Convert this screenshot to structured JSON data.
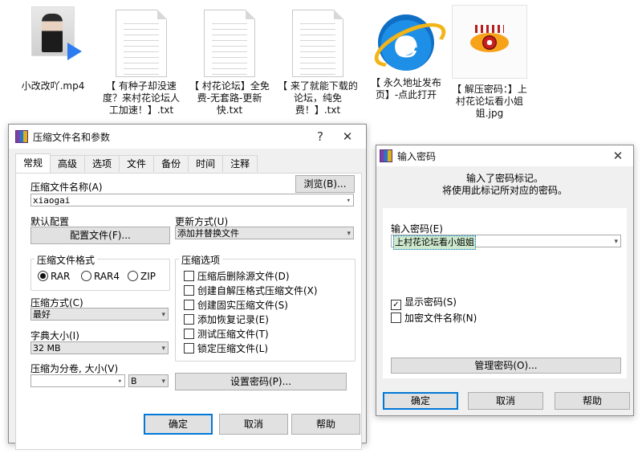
{
  "desktop": {
    "icons": [
      {
        "label": "小改改吖.mp4",
        "kind": "video"
      },
      {
        "label": "【 有种子却没速度？来村花论坛人工加速！】.txt",
        "kind": "txt"
      },
      {
        "label": "【 村花论坛】全免费-无套路-更新快.txt",
        "kind": "txt"
      },
      {
        "label": "【 来了就能下载的论坛，纯免费！】.txt",
        "kind": "txt"
      },
      {
        "label": "【 永久地址发布页】-点此打开",
        "kind": "ie"
      },
      {
        "label": "【 解压密码：】上村花论坛看小姐姐.jpg",
        "kind": "jpg"
      }
    ]
  },
  "archive_dialog": {
    "title": "压缩文件名和参数",
    "help_glyph": "?",
    "close_glyph": "✕",
    "tabs": [
      "常规",
      "高级",
      "选项",
      "文件",
      "备份",
      "时间",
      "注释"
    ],
    "archive_name_label": "压缩文件名称(A)",
    "browse_button": "浏览(B)...",
    "archive_name_value": "xiaogai",
    "default_profile_label": "默认配置",
    "profile_button": "配置文件(F)...",
    "update_mode_label": "更新方式(U)",
    "update_mode_value": "添加并替换文件",
    "format_group_title": "压缩文件格式",
    "formats": [
      "RAR",
      "RAR4",
      "ZIP"
    ],
    "format_selected": "RAR",
    "options_group_title": "压缩选项",
    "options": [
      "压缩后删除源文件(D)",
      "创建自解压格式压缩文件(X)",
      "创建固实压缩文件(S)",
      "添加恢复记录(E)",
      "测试压缩文件(T)",
      "锁定压缩文件(L)"
    ],
    "method_label": "压缩方式(C)",
    "method_value": "最好",
    "dict_label": "字典大小(I)",
    "dict_value": "32 MB",
    "split_label": "压缩为分卷, 大小(V)",
    "split_value": "",
    "split_unit": "B",
    "set_password_button": "设置密码(P)...",
    "ok_button": "确定",
    "cancel_button": "取消",
    "help_button": "帮助"
  },
  "password_dialog": {
    "title": "输入密码",
    "close_glyph": "✕",
    "message_line1": "输入了密码标记。",
    "message_line2": "将使用此标记所对应的密码。",
    "enter_label": "输入密码(E)",
    "password_value": "上村花论坛看小姐姐",
    "show_password_label": "显示密码(S)",
    "show_password_checked": true,
    "encrypt_names_label": "加密文件名称(N)",
    "encrypt_names_checked": false,
    "manage_button": "管理密码(O)...",
    "ok_button": "确定",
    "cancel_button": "取消",
    "help_button": "帮助"
  },
  "colors": {
    "selection": "#0078d7",
    "highlight_bg": "#cde8cd",
    "dialog_bg": "#f0f0f0"
  }
}
